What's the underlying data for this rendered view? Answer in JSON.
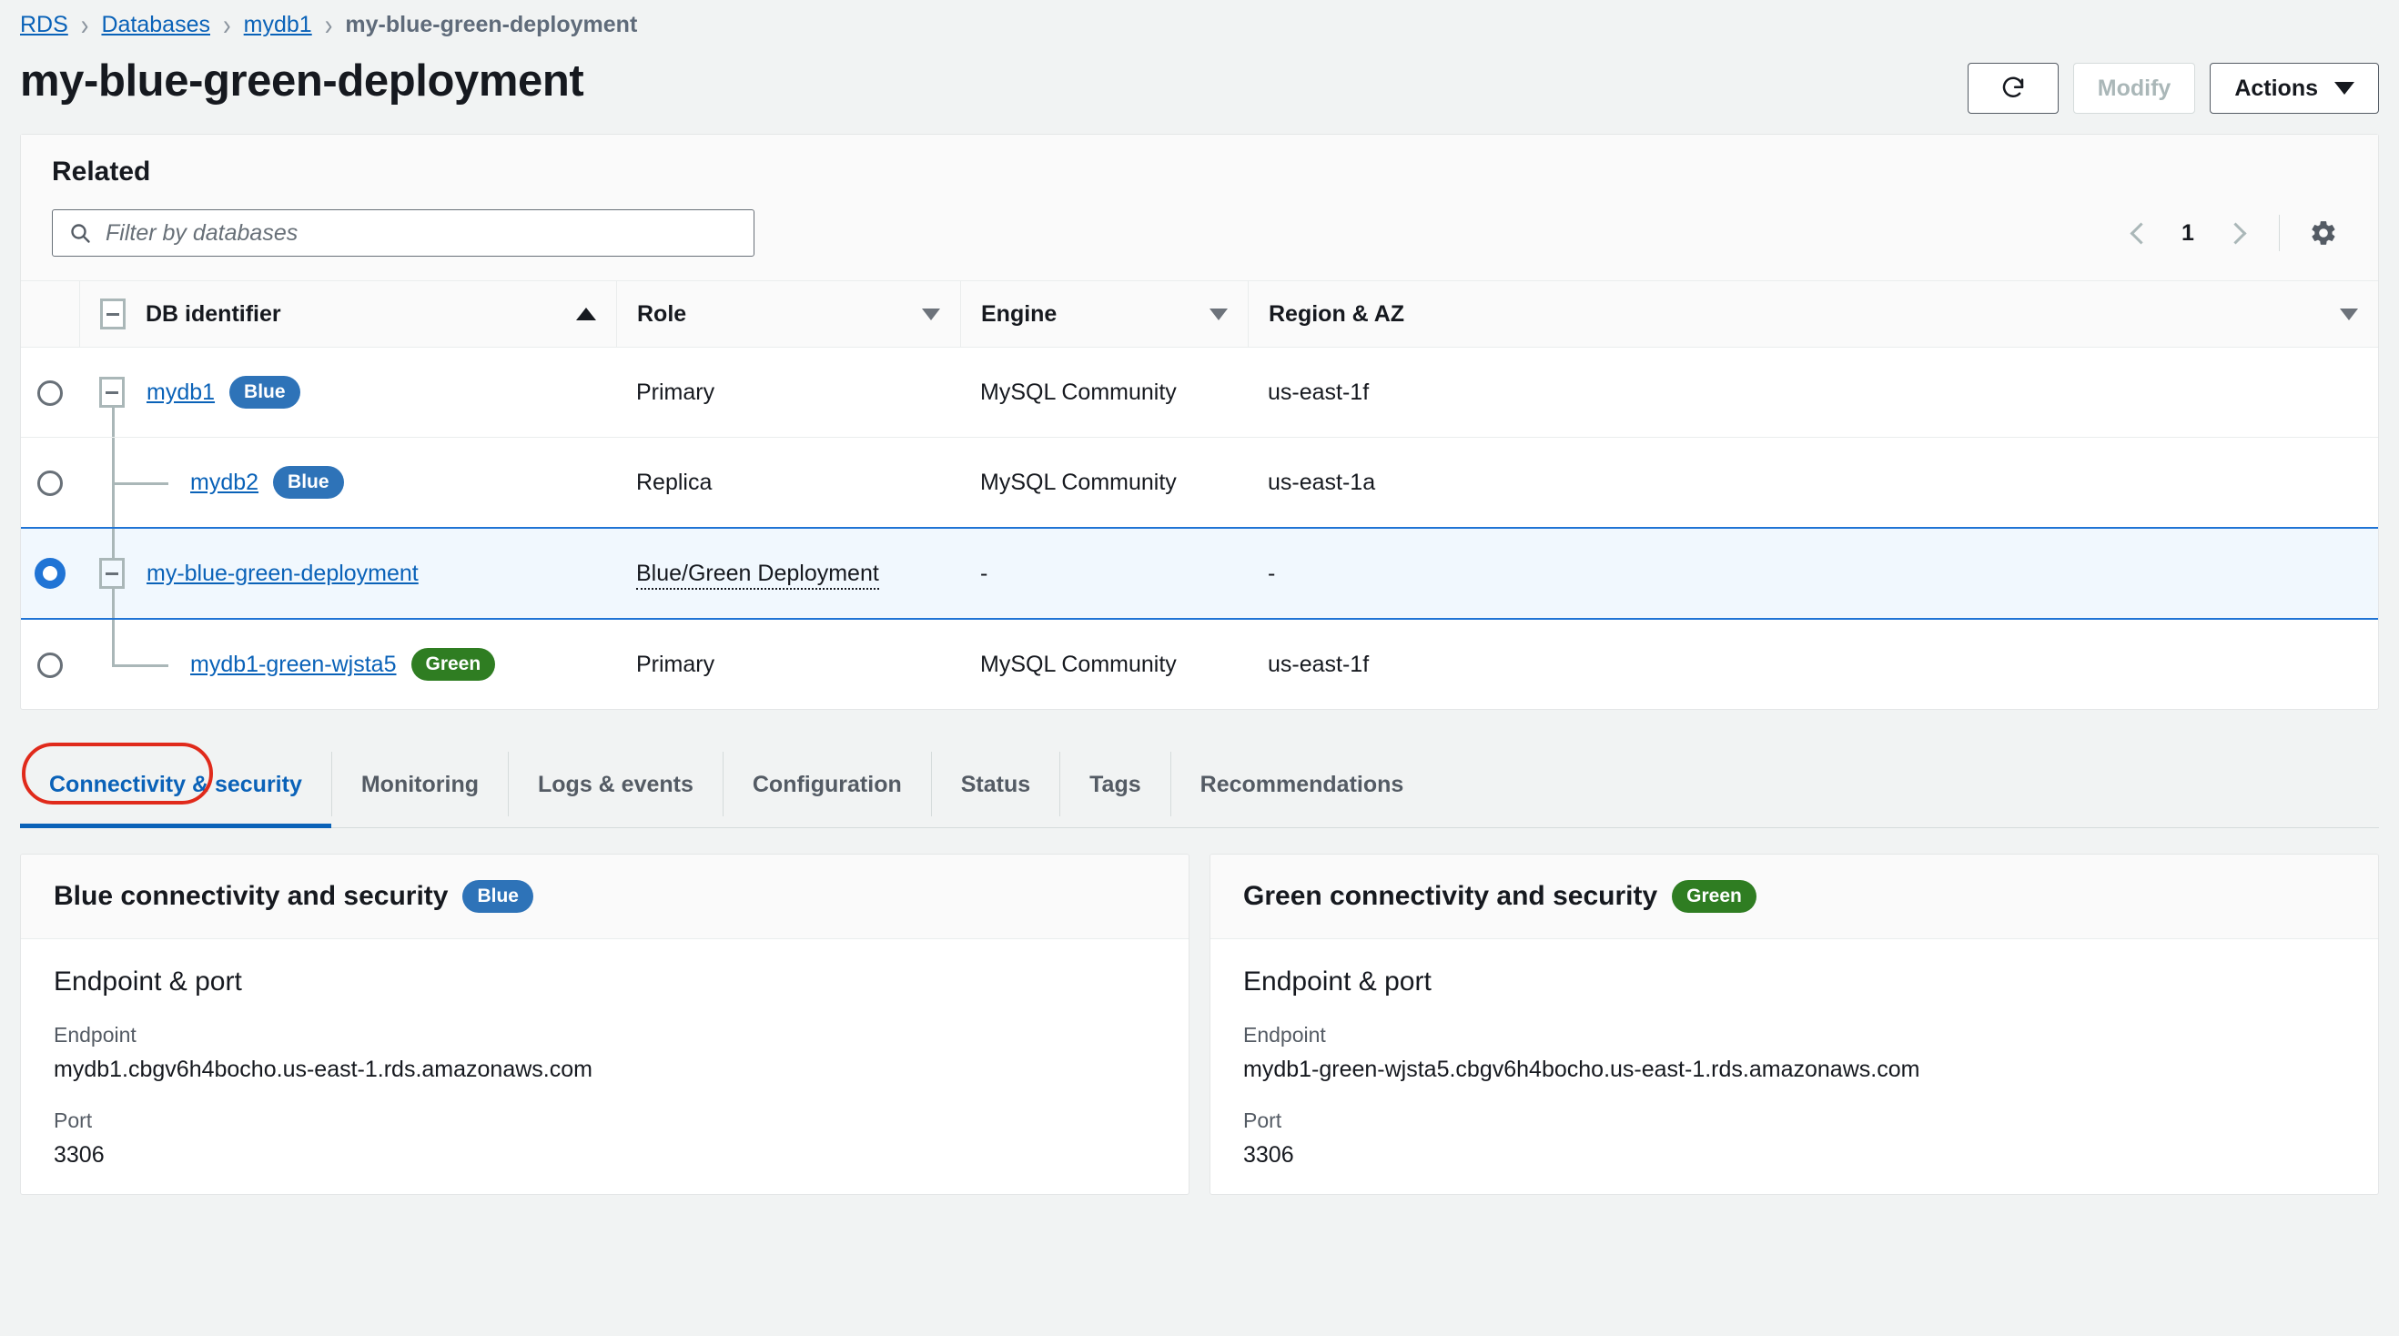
{
  "breadcrumb": {
    "items": [
      {
        "label": "RDS",
        "current": false
      },
      {
        "label": "Databases",
        "current": false
      },
      {
        "label": "mydb1",
        "current": false
      },
      {
        "label": "my-blue-green-deployment",
        "current": true
      }
    ],
    "separator": "›"
  },
  "header": {
    "title": "my-blue-green-deployment",
    "refresh_label": "↻",
    "modify_label": "Modify",
    "actions_label": "Actions"
  },
  "related": {
    "title": "Related",
    "search": {
      "placeholder": "Filter by databases",
      "value": ""
    },
    "pagination": {
      "prev_label": "previous-page",
      "page": "1",
      "next_label": "next-page"
    },
    "settings_label": "preferences",
    "columns": [
      {
        "label": "DB identifier",
        "sort": "asc"
      },
      {
        "label": "Role",
        "sort": "none"
      },
      {
        "label": "Engine",
        "sort": "none"
      },
      {
        "label": "Region & AZ",
        "sort": "none"
      }
    ],
    "rows": [
      {
        "id": "mydb1",
        "badge": "Blue",
        "badge_color": "#2e73b8",
        "role": "Primary",
        "engine": "MySQL Community",
        "region": "us-east-1f",
        "selected": false
      },
      {
        "id": "mydb2",
        "badge": "Blue",
        "badge_color": "#2e73b8",
        "role": "Replica",
        "engine": "MySQL Community",
        "region": "us-east-1a",
        "selected": false
      },
      {
        "id": "my-blue-green-deployment",
        "badge": "",
        "badge_color": "",
        "role": "Blue/Green Deployment",
        "engine": "-",
        "region": "-",
        "selected": true
      },
      {
        "id": "mydb1-green-wjsta5",
        "badge": "Green",
        "badge_color": "#2f7d22",
        "role": "Primary",
        "engine": "MySQL Community",
        "region": "us-east-1f",
        "selected": false
      }
    ]
  },
  "tabs": [
    {
      "label": "Connectivity & security",
      "active": true
    },
    {
      "label": "Monitoring",
      "active": false
    },
    {
      "label": "Logs & events",
      "active": false
    },
    {
      "label": "Configuration",
      "active": false
    },
    {
      "label": "Status",
      "active": false
    },
    {
      "label": "Tags",
      "active": false
    },
    {
      "label": "Recommendations",
      "active": false
    }
  ],
  "annotation": {
    "color": "#e02a1b",
    "target": "Connectivity & security"
  },
  "blue_panel": {
    "title": "Blue connectivity and security",
    "badge": "Blue",
    "section": "Endpoint & port",
    "endpoint_label": "Endpoint",
    "endpoint_value": "mydb1.cbgv6h4bocho.us-east-1.rds.amazonaws.com",
    "port_label": "Port",
    "port_value": "3306"
  },
  "green_panel": {
    "title": "Green connectivity and security",
    "badge": "Green",
    "section": "Endpoint & port",
    "endpoint_label": "Endpoint",
    "endpoint_value": "mydb1-green-wjsta5.cbgv6h4bocho.us-east-1.rds.amazonaws.com",
    "port_label": "Port",
    "port_value": "3306"
  }
}
